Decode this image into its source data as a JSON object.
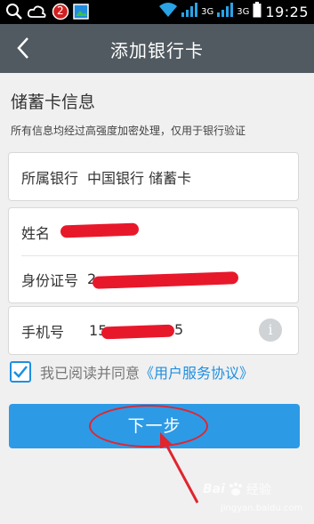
{
  "status_bar": {
    "network_3g_1": "3G",
    "network_3g_2": "3G",
    "time": "19:25",
    "notification_badge": "2"
  },
  "titlebar": {
    "title": "添加银行卡"
  },
  "section": {
    "title": "储蓄卡信息",
    "subtitle": "所有信息均经过高强度加密处理，仅用于银行验证"
  },
  "bank_row": {
    "label": "所属银行",
    "value": "中国银行 储蓄卡"
  },
  "name_row": {
    "label": "姓名"
  },
  "id_row": {
    "label": "身份证号",
    "value_prefix": "2"
  },
  "phone_row": {
    "label": "手机号",
    "value_prefix": "15",
    "value_suffix": "5",
    "info_glyph": "i"
  },
  "agreement": {
    "checked": true,
    "text": "我已阅读并同意",
    "link": "《用户服务协议》"
  },
  "next_button": {
    "label": "下一步"
  },
  "watermark": {
    "brand": "Bai",
    "brand_suffix": "经验",
    "sub": "jingyan.baidu.com"
  },
  "colors": {
    "titlebar": "#505a60",
    "accent": "#2d9ae6",
    "link": "#1e8fe1",
    "annotation": "#e0252f"
  }
}
